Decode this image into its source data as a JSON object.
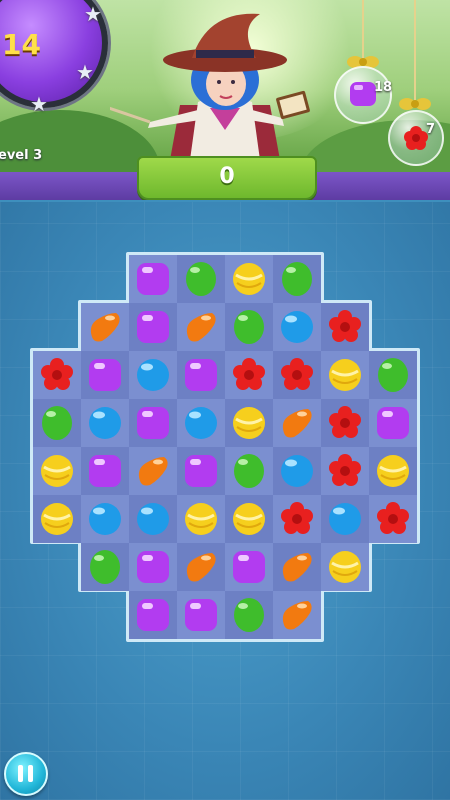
{
  "hud": {
    "moves_left": "14",
    "level_label": "evel 3",
    "score": "0"
  },
  "goals": [
    {
      "candy": "purple-square",
      "count": "18"
    },
    {
      "candy": "red-flower",
      "count": "7"
    }
  ],
  "board": {
    "rows": [
      [
        null,
        null,
        "purple",
        "green",
        "yellow",
        "green",
        null,
        null
      ],
      [
        null,
        "orange",
        "purple",
        "orange",
        "green",
        "blue",
        "red",
        null
      ],
      [
        "red",
        "purple",
        "blue",
        "purple",
        "red",
        "red",
        "yellow",
        "green"
      ],
      [
        "green",
        "blue",
        "purple",
        "blue",
        "yellow",
        "orange",
        "red",
        "purple"
      ],
      [
        "yellow",
        "purple",
        "orange",
        "purple",
        "green",
        "blue",
        "red",
        "yellow"
      ],
      [
        "yellow",
        "blue",
        "blue",
        "yellow",
        "yellow",
        "red",
        "blue",
        "red"
      ],
      [
        null,
        "green",
        "purple",
        "orange",
        "purple",
        "orange",
        "yellow",
        null
      ],
      [
        null,
        null,
        "purple",
        "purple",
        "green",
        "orange",
        null,
        null
      ]
    ]
  },
  "colors": {
    "purple": "#b23cf0",
    "green": "#3fbd2c",
    "yellow": "#f6cf1d",
    "orange": "#f27a10",
    "blue": "#1f9be8",
    "red": "#e8201f"
  }
}
